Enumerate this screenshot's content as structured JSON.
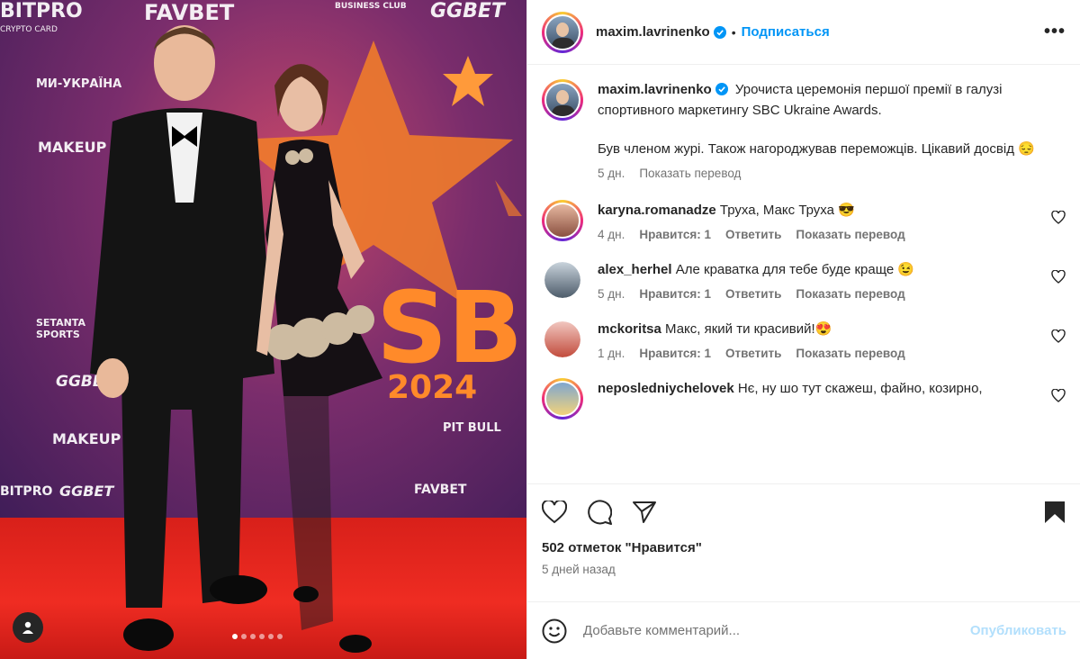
{
  "post": {
    "author": "maxim.lavrinenko",
    "follow_label": "Подписаться",
    "more_label": "•••",
    "caption_line1": "Урочиста церемонія першої премії в галузі спортивного маркетингу SBC Ukraine Awards.",
    "caption_line2": "Був членом журі. Також нагороджував переможців. Цікавий досвід 😔",
    "caption_time": "5 дн.",
    "caption_translate": "Показать перевод",
    "likes": "502 отметок \"Нравится\"",
    "posted_ago": "5 дней назад"
  },
  "media": {
    "banner_texts": [
      "BITPRO",
      "FAVBET",
      "GGBET",
      "МИ-УКРАЇНА",
      "MAKEUP",
      "SETANTA SPORTS",
      "2024",
      "SBC",
      "BUSINESS CLUB",
      "CRYPTO CARD",
      "PIT BULL"
    ],
    "carousel_count": 6,
    "carousel_active": 0
  },
  "comments": [
    {
      "user": "karyna.romanadze",
      "text": "Труха, Макс Труха 😎",
      "time": "4 дн.",
      "likes": "Нравится: 1",
      "reply": "Ответить",
      "translate": "Показать перевод"
    },
    {
      "user": "alex_herhel",
      "text": "Але краватка для тебе буде краще 😉",
      "time": "5 дн.",
      "likes": "Нравится: 1",
      "reply": "Ответить",
      "translate": "Показать перевод"
    },
    {
      "user": "mckoritsa",
      "text": "Макс, який ти красивий!😍",
      "time": "1 дн.",
      "likes": "Нравится: 1",
      "reply": "Ответить",
      "translate": "Показать перевод"
    },
    {
      "user": "neposledniychelovek",
      "text": "Нє, ну шо тут скажеш, файно, козирно,",
      "time": "",
      "likes": "",
      "reply": "",
      "translate": ""
    }
  ],
  "composer": {
    "placeholder": "Добавьте комментарий...",
    "publish": "Опубликовать"
  },
  "colors": {
    "accent": "#0095f6",
    "muted": "#737373",
    "text": "#262626"
  }
}
